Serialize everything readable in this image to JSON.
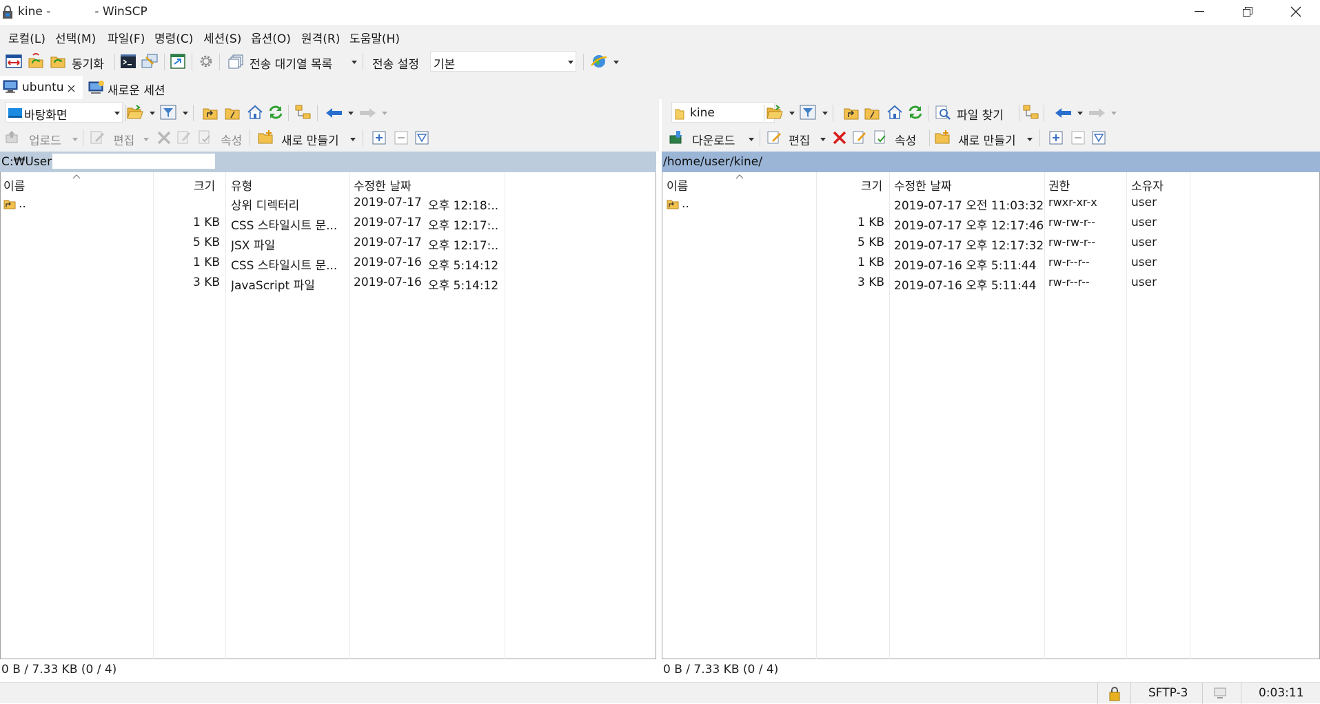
{
  "window": {
    "title_prefix": "kine -",
    "title_app": "- WinSCP"
  },
  "menu": [
    "로컬(L)",
    "선택(M)",
    "파일(F)",
    "명령(C)",
    "세션(S)",
    "옵션(O)",
    "원격(R)",
    "도움말(H)"
  ],
  "toolbar": {
    "sync_label": "동기화",
    "queue_label": "전송 대기열 목록",
    "transfer_settings_label": "전송 설정",
    "transfer_settings_value": "기본"
  },
  "tabs": {
    "session": "ubuntu",
    "new_session": "새로운 세션"
  },
  "local": {
    "location": "바탕화면",
    "upload": "업로드",
    "edit": "편집",
    "properties": "속성",
    "new": "새로 만들기",
    "path": "C:₩Users",
    "columns": [
      "이름",
      "크기",
      "유형",
      "수정한 날짜"
    ],
    "rows": [
      {
        "name": "..",
        "size": "",
        "type": "상위 디렉터리",
        "date": "2019-07-17",
        "time": "오후 12:18:..."
      },
      {
        "name": "",
        "size": "1 KB",
        "type": "CSS 스타일시트 문...",
        "date": "2019-07-17",
        "time": "오후 12:17:..."
      },
      {
        "name": "",
        "size": "5 KB",
        "type": "JSX 파일",
        "date": "2019-07-17",
        "time": "오후 12:17:..."
      },
      {
        "name": "",
        "size": "1 KB",
        "type": "CSS 스타일시트 문...",
        "date": "2019-07-16",
        "time": "오후 5:14:12"
      },
      {
        "name": "",
        "size": "3 KB",
        "type": "JavaScript 파일",
        "date": "2019-07-16",
        "time": "오후 5:14:12"
      }
    ],
    "status": "0 B / 7.33 KB (0 / 4)"
  },
  "remote": {
    "location": "kine",
    "find": "파일 찾기",
    "download": "다운로드",
    "edit": "편집",
    "properties": "속성",
    "new": "새로 만들기",
    "path": "/home/user/kine/",
    "columns": [
      "이름",
      "크기",
      "수정한 날짜",
      "권한",
      "소유자"
    ],
    "rows": [
      {
        "name": "..",
        "size": "",
        "date": "2019-07-17 오전 11:03:32",
        "perm": "rwxr-xr-x",
        "owner": "user"
      },
      {
        "name": "",
        "size": "1 KB",
        "date": "2019-07-17 오후 12:17:46",
        "perm": "rw-rw-r--",
        "owner": "user"
      },
      {
        "name": "",
        "size": "5 KB",
        "date": "2019-07-17 오후 12:17:32",
        "perm": "rw-rw-r--",
        "owner": "user"
      },
      {
        "name": "",
        "size": "1 KB",
        "date": "2019-07-16 오후 5:11:44",
        "perm": "rw-r--r--",
        "owner": "user"
      },
      {
        "name": "",
        "size": "3 KB",
        "date": "2019-07-16 오후 5:11:44",
        "perm": "rw-r--r--",
        "owner": "user"
      }
    ],
    "status": "0 B / 7.33 KB (0 / 4)"
  },
  "statusbar": {
    "protocol": "SFTP-3",
    "elapsed": "0:03:11"
  }
}
